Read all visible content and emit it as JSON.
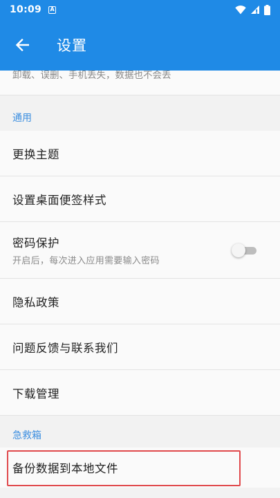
{
  "status_bar": {
    "time": "10:09",
    "notification_glyph": "A"
  },
  "app_bar": {
    "title": "设置",
    "back_icon": "arrow-left-icon"
  },
  "partial_text": "卸载、误删、手机丢失，数据也不会丢",
  "sections": {
    "general": {
      "header": "通用",
      "items": {
        "theme": {
          "label": "更换主题"
        },
        "widget_style": {
          "label": "设置桌面便签样式"
        },
        "password": {
          "label": "密码保护",
          "sub": "开启后，每次进入应用需要输入密码",
          "enabled": false
        },
        "privacy": {
          "label": "隐私政策"
        },
        "feedback": {
          "label": "问题反馈与联系我们"
        },
        "downloads": {
          "label": "下载管理"
        }
      }
    },
    "rescue": {
      "header": "急救箱",
      "items": {
        "backup": {
          "label": "备份数据到本地文件"
        }
      }
    }
  },
  "colors": {
    "accent": "#1f8ae6",
    "section_header": "#3d8fe0",
    "highlight": "#e0484b"
  }
}
